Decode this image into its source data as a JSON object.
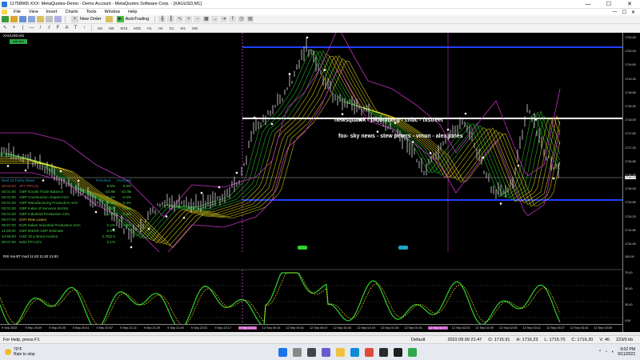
{
  "window": {
    "title": "11758965 XXX: MetaQuotes-Demo - Demo Account - MetaQuotes Software Corp. - [XAUUSD,M1]",
    "controls": [
      "—",
      "☐",
      "✕"
    ]
  },
  "menu": {
    "items": [
      "File",
      "View",
      "Insert",
      "Charts",
      "Tools",
      "Window",
      "Help"
    ]
  },
  "toolbar": {
    "new_order": "New Order",
    "autotrading": "AutoTrading",
    "timeframes": [
      "M1",
      "M5",
      "M15",
      "M30",
      "H1",
      "H4",
      "D1",
      "W1",
      "MN"
    ]
  },
  "chart": {
    "symbol": "XAUUSD,M1",
    "badge": "Ask line",
    "news_line1": "newsquawk - bloomberg - cnbc - fxstreet",
    "news_line2": "fox- sky news - stew peters - vmon - alex jones",
    "price_labels": [
      "1720.45",
      "1720.05",
      "1719.65",
      "1719.25",
      "1718.85",
      "1718.45",
      "1718.05",
      "1717.65",
      "1717.25",
      "1716.85",
      "1716.45",
      "1716.05",
      "1715.65",
      "1715.25",
      "1714.85",
      "1714.45"
    ],
    "current_price": "1716.23",
    "rsi_label": "RSI ma BT mod 11.83 11.83 13.83",
    "rsi_levels": [
      "100.00",
      "70.00",
      "50.00",
      "30.00",
      "0.00"
    ],
    "time_labels": [
      "9 Sep 2022",
      "9 Sep 20:09",
      "9 Sep 20:25",
      "9 Sep 20:41",
      "9 Sep 20:57",
      "9 Sep 21:13",
      "9 Sep 21:29",
      "9 Sep 21:45",
      "9 Sep 22:01",
      "9 Sep 22:17",
      "9 Sep 22:33",
      "12 Sep 00:15",
      "12 Sep 00:31",
      "12 Sep 00:47",
      "12 Sep 01:03",
      "12 Sep 01:19",
      "12 Sep 01:35",
      "12 Sep 01:51",
      "12 Sep 02:07",
      "12 Sep 02:23",
      "12 Sep 02:39",
      "12 Sep 02:55",
      "12 Sep 03:11",
      "12 Sep 03:27",
      "12 Sep 03:43",
      "12 Sep 03:59"
    ]
  },
  "news_panel": {
    "header_left": "Next 11 Forex News",
    "header_mid": "Previous",
    "header_right": "Forecast",
    "rows": [
      {
        "time": "00:50:00",
        "event": "JPY PPI y/y",
        "prev": "8.6%",
        "fcst": "8.9%",
        "tone": "red"
      },
      {
        "time": "03:01:00",
        "event": "GBP Goods Trade Balance",
        "prev": "-22.8B",
        "fcst": "-22.0B",
        "tone": "green"
      },
      {
        "time": "03:01:00",
        "event": "GBP Construction Output m/m",
        "prev": "-1.4%",
        "fcst": "0.5%",
        "tone": "green"
      },
      {
        "time": "03:01:00",
        "event": "GBP Manufacturing Production m/m",
        "prev": "-0.3%",
        "fcst": "0.3%",
        "tone": "green"
      },
      {
        "time": "03:01:00",
        "event": "GBP Index of Services 3m/3m",
        "prev": "-0.2%",
        "fcst": "0.2%",
        "tone": "green"
      },
      {
        "time": "03:01:00",
        "event": "GBP Industrial Production m/m",
        "prev": "-0.9%",
        "fcst": "0.3%",
        "tone": "green"
      },
      {
        "time": "05:57:00",
        "event": "CNY New Loans",
        "prev": "",
        "fcst": "",
        "tone": "yellow"
      },
      {
        "time": "05:57:00",
        "event": "EUR Italian Industrial Production m/m",
        "prev": "-2.1%",
        "fcst": "0.6%",
        "tone": "green"
      },
      {
        "time": "11:00:00",
        "event": "GBP NIESR GDP Estimate",
        "prev": "0.0%",
        "fcst": "",
        "tone": "green"
      },
      {
        "time": "14:58:00",
        "event": "USD 10-y Bond Auction",
        "prev": "2.76|2.5",
        "fcst": "",
        "tone": "green"
      },
      {
        "time": "00:07:00",
        "event": "NZD FPI m/m",
        "prev": "2.1%",
        "fcst": "",
        "tone": "green"
      }
    ]
  },
  "status": {
    "help": "For Help, press F1",
    "profile": "Default",
    "datetime": "2022.09.09 21:47",
    "open": "O: 1715.91",
    "high": "H: 1716.23",
    "low": "L: 1715.70",
    "close": "C: 1716.20",
    "volume": "V: 46",
    "traffic": "223/0 kb"
  },
  "taskbar": {
    "temp": "70°F",
    "weather": "Rain to stop",
    "time": "9:02 PM",
    "date": "9/11/2022"
  },
  "colors": {
    "green": "#2fd12f",
    "yellow": "#f0e020",
    "magenta": "#c030c0",
    "blue": "#2040ff"
  }
}
